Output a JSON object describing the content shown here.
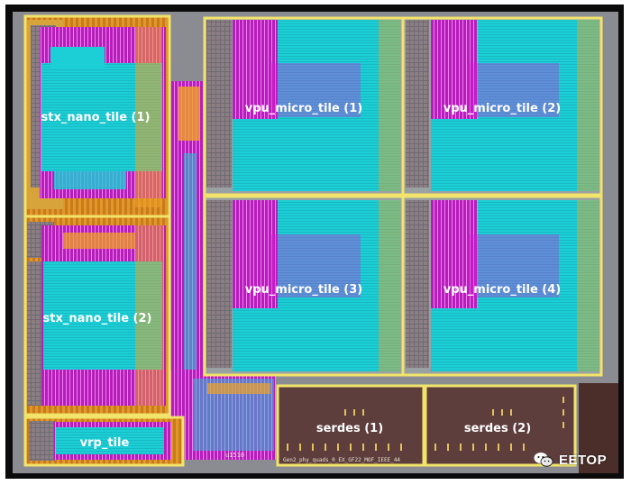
{
  "blocks": [
    {
      "id": "stx1",
      "label": "stx_nano_tile (1)",
      "kind": "stx"
    },
    {
      "id": "stx2",
      "label": "stx_nano_tile (2)",
      "kind": "stx"
    },
    {
      "id": "vrp",
      "label": "vrp_tile",
      "kind": "vrp"
    },
    {
      "id": "vpu1",
      "label": "vpu_micro_tile (1)",
      "kind": "vpu"
    },
    {
      "id": "vpu2",
      "label": "vpu_micro_tile (2)",
      "kind": "vpu"
    },
    {
      "id": "vpu3",
      "label": "vpu_micro_tile (3)",
      "kind": "vpu"
    },
    {
      "id": "vpu4",
      "label": "vpu_micro_tile (4)",
      "kind": "vpu"
    },
    {
      "id": "serdes1",
      "label": "serdes (1)",
      "kind": "serdes"
    },
    {
      "id": "serdes2",
      "label": "serdes (2)",
      "kind": "serdes"
    }
  ],
  "small_text": {
    "cell_label": "u1510",
    "macro_label": "Gen2_phy_quads_0_EX_GF22_MOF_IEEE_44"
  },
  "watermark": {
    "text": "EETOP",
    "icon": "wechat-icon"
  },
  "colors": {
    "frame": "#0b0b0b",
    "tile_border": "#f2e46a",
    "cyan": "#1ccfd6",
    "magenta": "#d81adb",
    "orange": "#f0a326",
    "serdes": "#5e3e3c",
    "background_gray": "#8a8c92"
  }
}
